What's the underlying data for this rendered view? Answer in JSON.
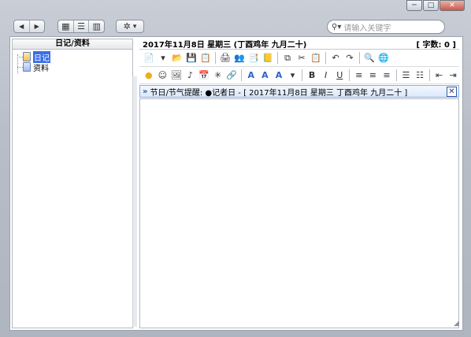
{
  "window_controls": {
    "minimize": "─",
    "maximize": "□",
    "close": "✕"
  },
  "toolbar": {
    "back_icon": "◀",
    "forward_icon": "▶",
    "view_icons_icon": "▦",
    "view_list_icon": "☰",
    "view_columns_icon": "▥",
    "settings_icon": "✲",
    "settings_dropdown": "▾"
  },
  "search": {
    "placeholder": "请输入关键字",
    "icon": "search-icon",
    "icon_glyph": "⚲▾"
  },
  "left_panel": {
    "title": "日记/资料",
    "tree": [
      {
        "label": "日记",
        "selected": true
      },
      {
        "label": "资料",
        "selected": false
      }
    ]
  },
  "editor_header": {
    "date": "2017年11月8日  星期三  (丁酉鸡年 九月二十)",
    "word_count": "[ 字数: 0 ]"
  },
  "format_toolbar_row1": [
    "📄",
    "▾",
    "📂",
    "💾",
    "📋",
    "|",
    "🖨",
    "👥",
    "📑",
    "📒",
    "|",
    "⧉",
    "✂",
    "📋",
    "|",
    "↶",
    "↷",
    "|",
    "🔍",
    "🌐"
  ],
  "format_toolbar_row2": [
    "●",
    "☺",
    "🖼",
    "♪",
    "📅",
    "✳",
    "🔗",
    "|",
    "A",
    "A",
    "A",
    "▾",
    "|",
    "B",
    "I",
    "U",
    "|",
    "≡",
    "≡",
    "≡",
    "|",
    "☰",
    "☷",
    "|",
    "⇤",
    "⇥"
  ],
  "reminder": {
    "arrows": "»",
    "text": "节日/节气提醒: ●记者日 - [ 2017年11月8日  星期三  丁酉鸡年  九月二十 ]",
    "close": "✕"
  }
}
